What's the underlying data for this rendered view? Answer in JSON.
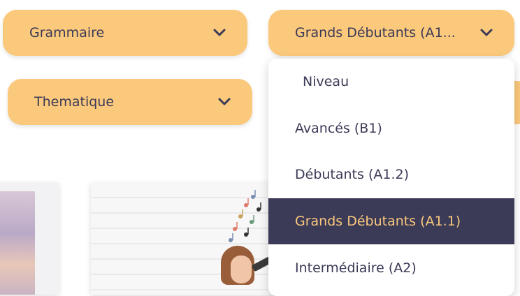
{
  "filters": {
    "grammaire": "Grammaire",
    "niveau": "Grands Débutants (A1...",
    "thematique": "Thematique"
  },
  "dropdown": {
    "header": "Niveau",
    "options": [
      "Avancés (B1)",
      "Débutants (A1.2)",
      "Grands Débutants (A1.1)",
      "Intermédiaire (A2)"
    ],
    "selected": "Grands Débutants (A1.1)"
  },
  "colors": {
    "select_bg": "#fbc97c",
    "text": "#3b3a57",
    "selected_bg": "#3b3a57",
    "selected_text": "#fbc97c"
  },
  "icons": {
    "chevron": "chevron-down-icon"
  }
}
